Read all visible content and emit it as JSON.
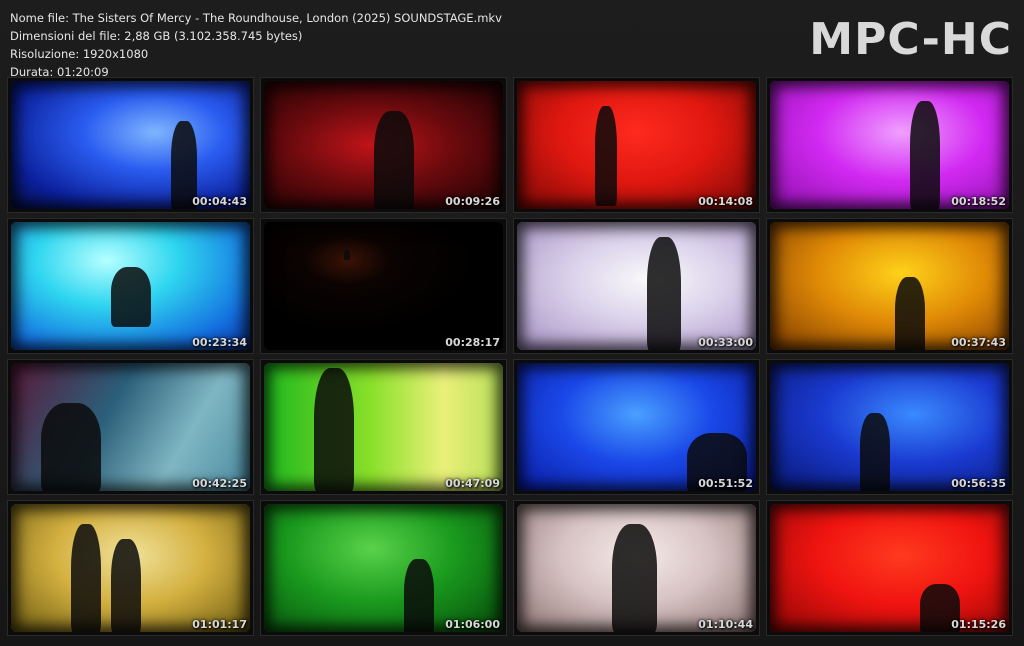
{
  "file_info": {
    "name": "Nome file: The Sisters Of Mercy - The Roundhouse, London (2025) SOUNDSTAGE.mkv",
    "size": "Dimensioni del file: 2,88 GB (3.102.358.745 bytes)",
    "resolution": "Risoluzione: 1920x1080",
    "duration": "Durata: 01:20:09"
  },
  "logo": "MPC-HC",
  "thumbnails": [
    {
      "time": "00:04:43",
      "bg": "radial-gradient(ellipse at 60% 40%, #7fb6ff 0%, #2a5cf0 35%, #0b1f9a 75%, #05104a 100%)"
    },
    {
      "time": "00:09:26",
      "bg": "radial-gradient(ellipse at 45% 50%, #c0141a 0%, #6a0a0d 45%, #1a0204 100%)"
    },
    {
      "time": "00:14:08",
      "bg": "radial-gradient(ellipse at 50% 40%, #ff2a1e 0%, #e01810 45%, #7a0806 100%)"
    },
    {
      "time": "00:18:52",
      "bg": "radial-gradient(ellipse at 55% 40%, #f0a0ff 0%, #d229f2 45%, #8a10a8 100%)"
    },
    {
      "time": "00:23:34",
      "bg": "radial-gradient(ellipse at 40% 30%, #b6ffff 0%, #2fd6f0 35%, #1470e0 75%, #0a2f9a 100%)"
    },
    {
      "time": "00:28:17",
      "bg": "radial-gradient(ellipse at 35% 30%, #3a1206 0%, #0a0302 20%, #000 60%)"
    },
    {
      "time": "00:33:00",
      "bg": "radial-gradient(ellipse at 55% 45%, #fafafa 0%, #dcd4ec 40%, #a48ec2 100%)"
    },
    {
      "time": "00:37:43",
      "bg": "radial-gradient(ellipse at 55% 40%, #ffd21a 0%, #e08a06 45%, #7a3802 100%)"
    },
    {
      "time": "00:42:25",
      "bg": "linear-gradient(120deg, #5a1a3a 0%, #2b5f7a 40%, #7fb6c2 70%, #4a8aa0 100%)"
    },
    {
      "time": "00:47:09",
      "bg": "linear-gradient(90deg, #1eb81e 0%, #8ae02a 45%, #eaf07a 75%, #b8e05a 100%)"
    },
    {
      "time": "00:51:52",
      "bg": "radial-gradient(ellipse at 50% 40%, #4aa0ff 0%, #1a48e8 45%, #0a1aa0 100%)"
    },
    {
      "time": "00:56:35",
      "bg": "radial-gradient(ellipse at 60% 40%, #3a8aff 0%, #1a3ad0 45%, #081670 100%)"
    },
    {
      "time": "01:01:17",
      "bg": "radial-gradient(ellipse at 50% 40%, #f0e29a 0%, #d4b040 45%, #6a5a10 100%)"
    },
    {
      "time": "01:06:00",
      "bg": "radial-gradient(ellipse at 45% 35%, #5ad24a 0%, #1a9a1e 45%, #064a0a 100%)"
    },
    {
      "time": "01:10:44",
      "bg": "radial-gradient(ellipse at 50% 40%, #f6ece8 0%, #d6c2c2 45%, #8a7070 100%)"
    },
    {
      "time": "01:15:26",
      "bg": "radial-gradient(ellipse at 55% 40%, #ff3a1e 0%, #f01410 45%, #8a0606 100%)"
    }
  ]
}
